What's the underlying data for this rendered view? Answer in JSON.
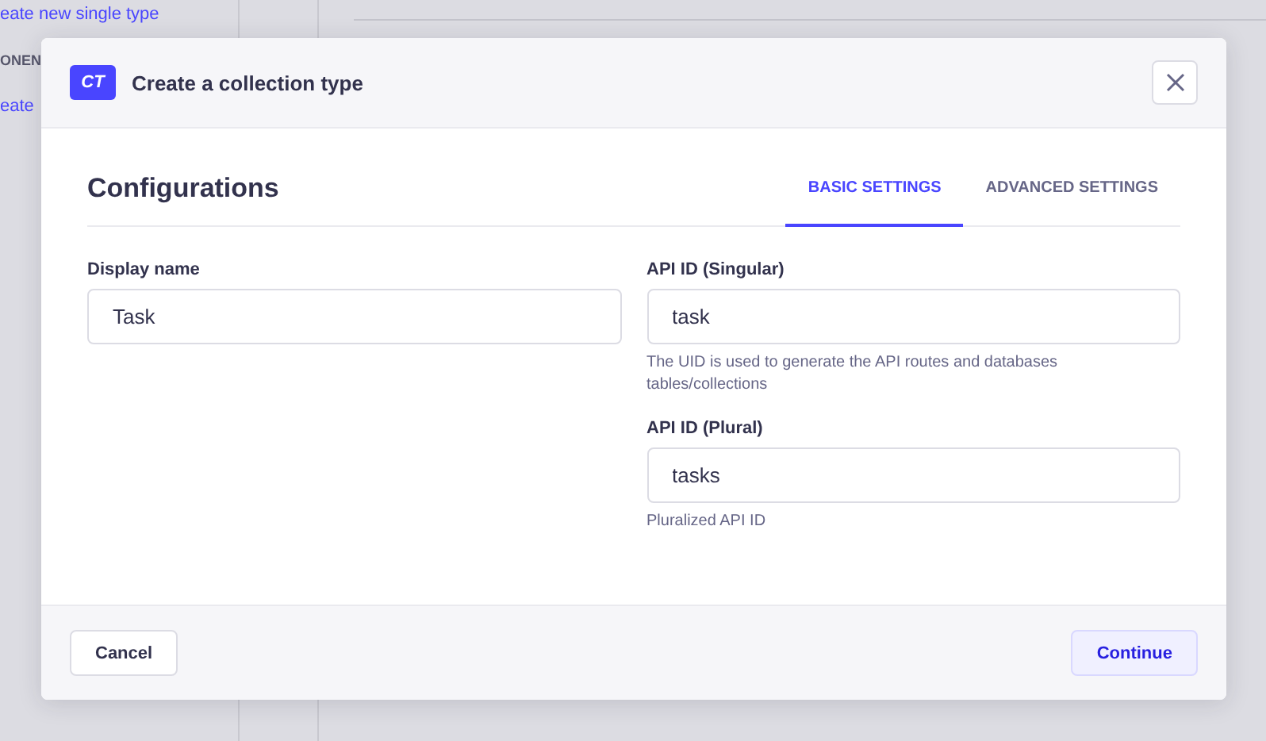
{
  "background": {
    "sidebar_items": [
      {
        "kind": "link",
        "text": "eate new single type"
      },
      {
        "kind": "section",
        "text": "ONEN"
      },
      {
        "kind": "link",
        "text": "eate"
      }
    ]
  },
  "modal": {
    "badge": "CT",
    "title": "Create a collection type",
    "heading": "Configurations",
    "tabs": [
      {
        "label": "BASIC SETTINGS",
        "selected": true
      },
      {
        "label": "ADVANCED SETTINGS",
        "selected": false
      }
    ],
    "left_fields": [
      {
        "label": "Display name",
        "value": "Task"
      }
    ],
    "right_fields": [
      {
        "label": "API ID (Singular)",
        "value": "task",
        "hint": "The UID is used to generate the API routes and databases tables/collections"
      },
      {
        "label": "API ID (Plural)",
        "value": "tasks",
        "hint": "Pluralized API ID"
      }
    ],
    "buttons": {
      "cancel": "Cancel",
      "continue": "Continue"
    }
  }
}
